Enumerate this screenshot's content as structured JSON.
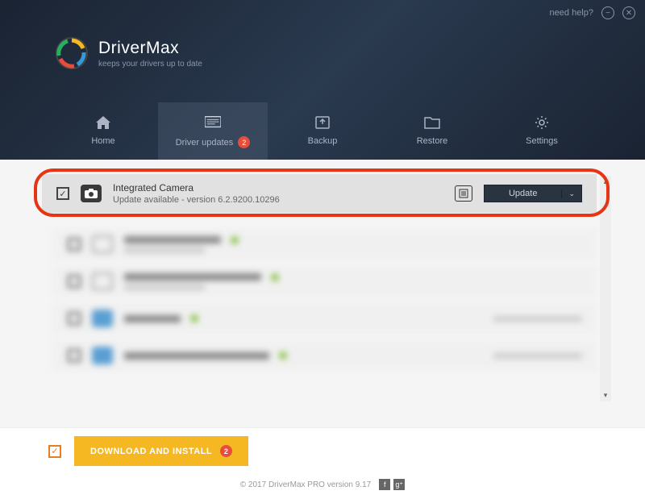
{
  "header": {
    "help_text": "need help?",
    "brand_title": "DriverMax",
    "brand_tagline": "keeps your drivers up to date"
  },
  "tabs": [
    {
      "id": "home",
      "label": "Home",
      "active": false,
      "badge": null
    },
    {
      "id": "updates",
      "label": "Driver updates",
      "active": true,
      "badge": "2"
    },
    {
      "id": "backup",
      "label": "Backup",
      "active": false,
      "badge": null
    },
    {
      "id": "restore",
      "label": "Restore",
      "active": false,
      "badge": null
    },
    {
      "id": "settings",
      "label": "Settings",
      "active": false,
      "badge": null
    }
  ],
  "drivers": {
    "highlighted": {
      "name": "Integrated Camera",
      "status": "Update available - version 6.2.9200.10296",
      "update_label": "Update"
    },
    "blurred": [
      {
        "name": "NVIDIA GeForce 210",
        "sub": "The driver is up-to-date",
        "has_green": true,
        "right_text": ""
      },
      {
        "name": "High Definition Audio Device",
        "sub": "The driver is up-to-date",
        "has_green": true,
        "right_text": ""
      },
      {
        "name": "Intel Device",
        "sub": "",
        "has_green": true,
        "right_text": "Driver updated on 03-Nov-16"
      },
      {
        "name": "Intel(R) 82801 PCI Bridge - 244E",
        "sub": "",
        "has_green": true,
        "right_text": "Driver updated on 03-Nov-16"
      }
    ]
  },
  "bottom": {
    "download_label": "DOWNLOAD AND INSTALL",
    "download_badge": "2"
  },
  "footer": {
    "copyright": "© 2017 DriverMax PRO version 9.17"
  }
}
